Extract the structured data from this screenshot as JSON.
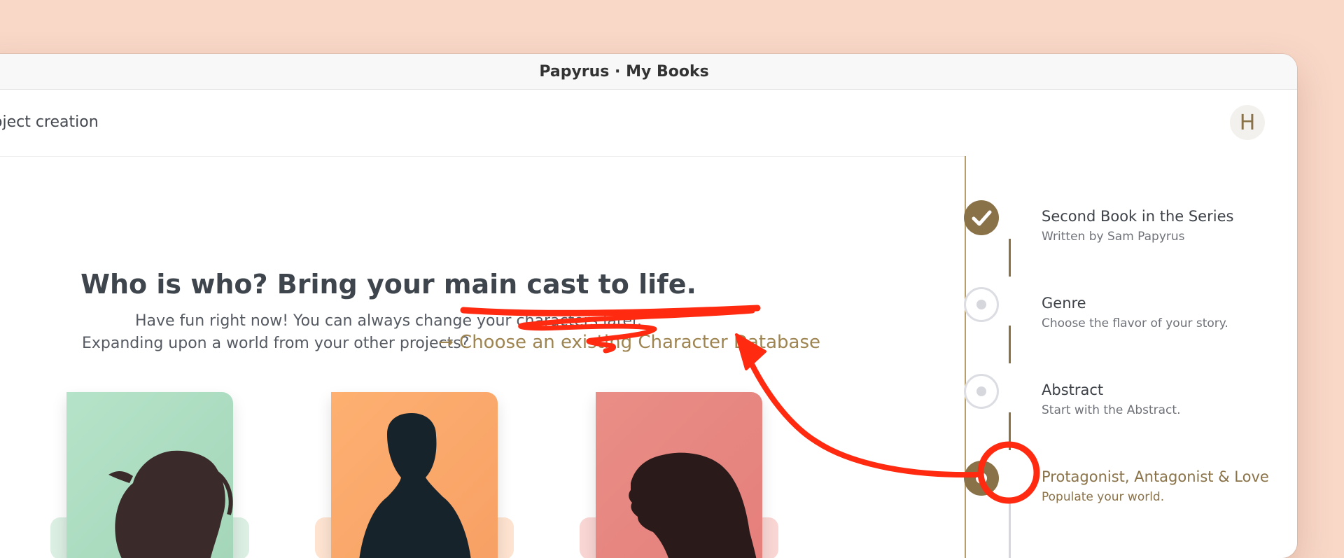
{
  "window": {
    "title": "Papyrus · My Books"
  },
  "toolbar": {
    "breadcrumb": "oject creation",
    "avatar_initial": "H"
  },
  "main": {
    "headline": "Who is who? Bring your main cast to life.",
    "subtitle_line1": "Have fun right now! You can always change your characters later.",
    "subtitle_line2": "Expanding upon a world from your other projects?",
    "database_link": "→ Choose an existing Character Database"
  },
  "characters": [
    {
      "role": "protagonist",
      "color": "#a9dcc0"
    },
    {
      "role": "antagonist",
      "color": "#f9a46b"
    },
    {
      "role": "love-interest",
      "color": "#e8857f"
    }
  ],
  "steps": [
    {
      "title": "Second Book in the Series",
      "subtitle": "Written by Sam Papyrus",
      "state": "done"
    },
    {
      "title": "Genre",
      "subtitle": "Choose the flavor of your story.",
      "state": "todo"
    },
    {
      "title": "Abstract",
      "subtitle": "Start with the Abstract.",
      "state": "todo"
    },
    {
      "title": "Protagonist, Antagonist & Love",
      "subtitle": "Populate your world.",
      "state": "active"
    }
  ],
  "colors": {
    "accent": "#8a7248",
    "link": "#9e8451",
    "annotation": "#ff2a10",
    "background": "#f9d8c8"
  }
}
